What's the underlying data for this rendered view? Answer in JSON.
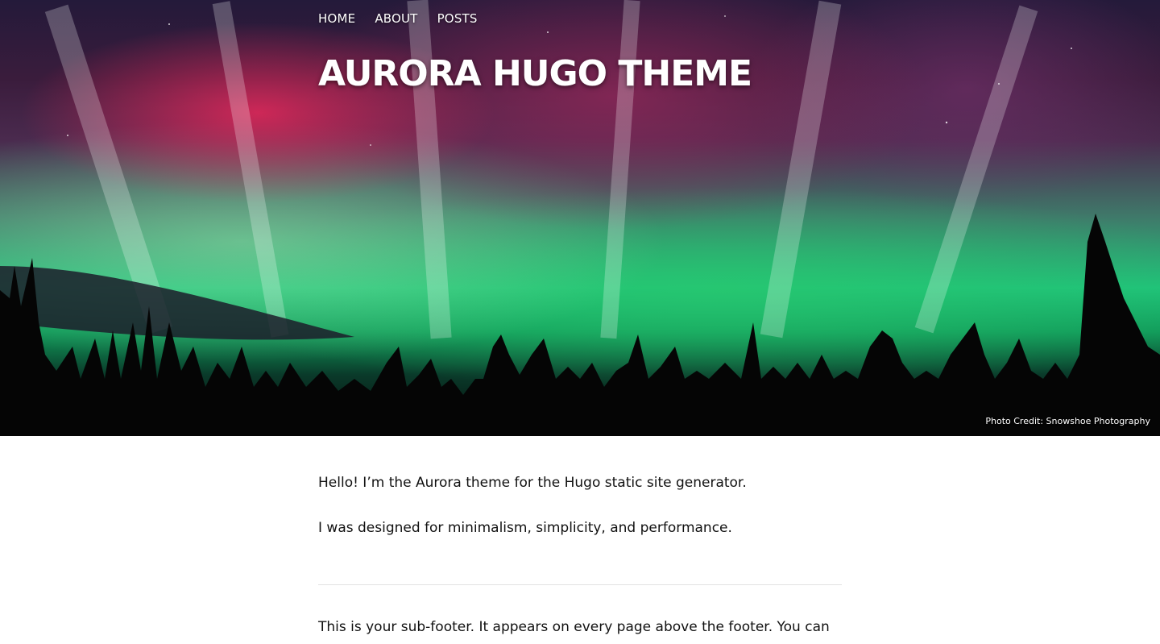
{
  "nav": {
    "items": [
      "HOME",
      "ABOUT",
      "POSTS"
    ]
  },
  "header": {
    "title": "AURORA HUGO THEME",
    "photo_credit": "Photo Credit: Snowshoe Photography"
  },
  "main": {
    "intro": "Hello! I’m the Aurora theme for the Hugo static site generator.",
    "design_note": "I was designed for minimalism, simplicity, and performance.",
    "sub_footer": "This is your sub-footer. It appears on every page above the footer. You can"
  },
  "colors": {
    "text": "#111111",
    "divider": "#e2e2e2",
    "hero_green": "#1fc27a",
    "hero_red": "#e6285a"
  }
}
